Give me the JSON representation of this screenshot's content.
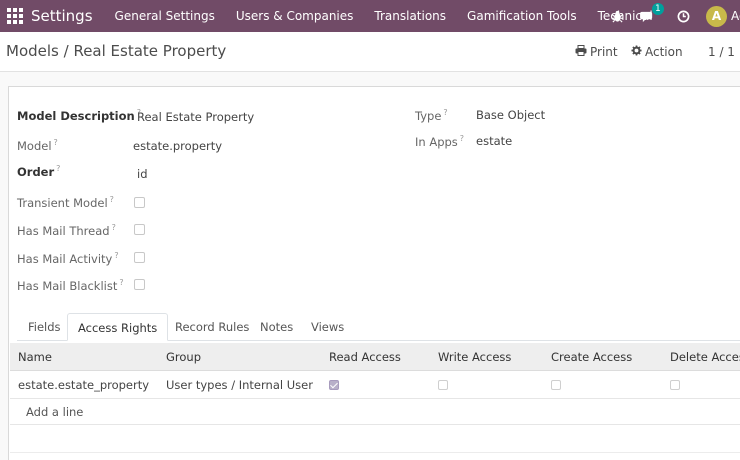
{
  "navbar": {
    "brand": "Settings",
    "menu": [
      "General Settings",
      "Users & Companies",
      "Translations",
      "Gamification Tools",
      "Technical"
    ],
    "messages_badge": "1",
    "user_initial": "A",
    "user_name": "Ac"
  },
  "control_panel": {
    "breadcrumb": "Models / Real Estate Property",
    "print_label": "Print",
    "action_label": "Action",
    "pager": "1 / 1"
  },
  "form": {
    "model_description_label": "Model Description",
    "model_description_value": "Real Estate Property",
    "model_label": "Model",
    "model_value": "estate.property",
    "order_label": "Order",
    "order_value": "id",
    "transient_label": "Transient Model",
    "mail_thread_label": "Has Mail Thread",
    "mail_activity_label": "Has Mail Activity",
    "mail_blacklist_label": "Has Mail Blacklist",
    "type_label": "Type",
    "type_value": "Base Object",
    "in_apps_label": "In Apps",
    "in_apps_value": "estate",
    "help_mark": "?"
  },
  "tabs": [
    "Fields",
    "Access Rights",
    "Record Rules",
    "Notes",
    "Views"
  ],
  "table": {
    "columns": [
      "Name",
      "Group",
      "Read Access",
      "Write Access",
      "Create Access",
      "Delete Access"
    ],
    "rows": [
      {
        "name": "estate.estate_property",
        "group": "User types / Internal User",
        "read": true,
        "write": false,
        "create": false,
        "delete": false
      }
    ],
    "add_line": "Add a line"
  }
}
